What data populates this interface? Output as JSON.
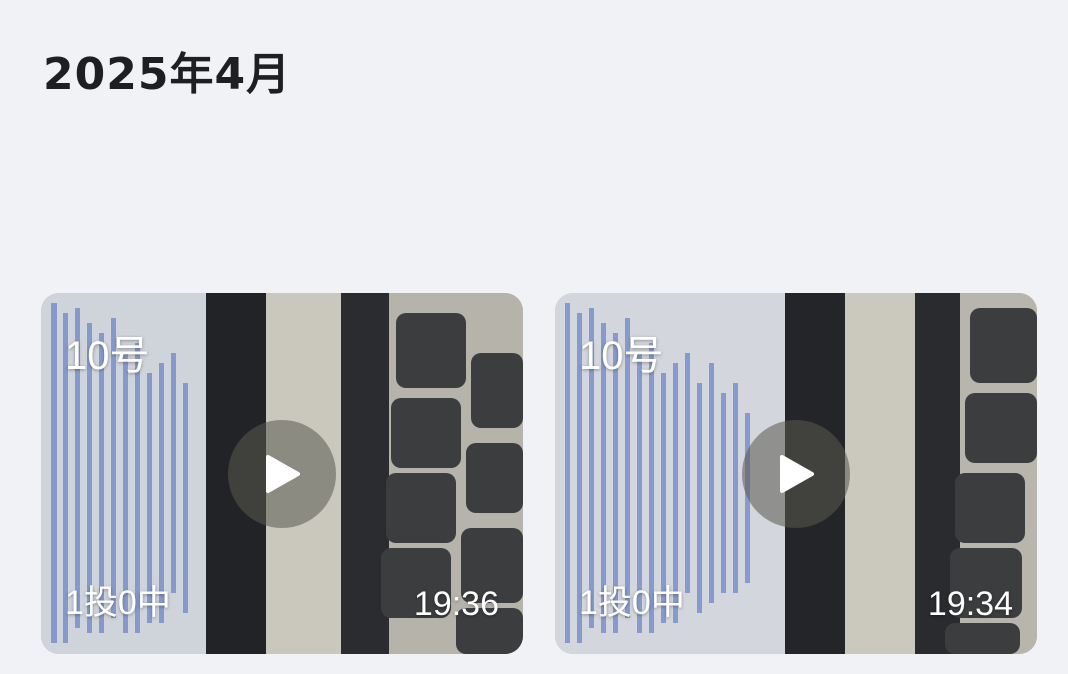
{
  "header": {
    "month": "2025年4月"
  },
  "videos": [
    {
      "label": "10号",
      "stat": "1投0中",
      "time": "19:36"
    },
    {
      "label": "10号",
      "stat": "1投0中",
      "time": "19:34"
    }
  ],
  "icons": {
    "play": "play-icon"
  }
}
